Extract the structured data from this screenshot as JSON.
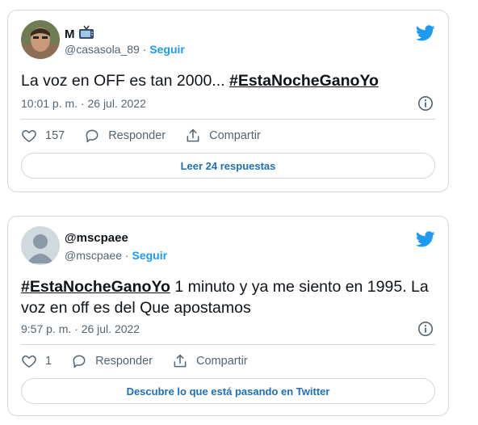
{
  "tweets": [
    {
      "name": "M",
      "name_emoji": "📺",
      "handle": "@casasola_89",
      "separator": "·",
      "follow_label": "Seguir",
      "text_before": "La voz en OFF es tan 2000... ",
      "hashtag": "#EstaNocheGanoYo",
      "text_after": "",
      "timestamp": "10:01 p. m. · 26 jul. 2022",
      "likes": "157",
      "reply_label": "Responder",
      "share_label": "Compartir",
      "footer_button": "Leer 24 respuestas"
    },
    {
      "name": "@mscpaee",
      "handle": "@mscpaee",
      "separator": "·",
      "follow_label": "Seguir",
      "hashtag": "#EstaNocheGanoYo",
      "text_after": " 1 minuto y ya me siento en 1995. La voz en off es del Que apostamos",
      "timestamp": "9:57 p. m. · 26 jul. 2022",
      "likes": "1",
      "reply_label": "Responder",
      "share_label": "Compartir",
      "footer_button": "Descubre lo que está pasando en Twitter"
    }
  ],
  "colors": {
    "brand": "#1d9bf0",
    "link": "#1d6fb8",
    "muted": "#536471",
    "border": "#cfd9de"
  },
  "icons": [
    "twitter-bird-icon",
    "info-icon",
    "heart-icon",
    "reply-bubble-icon",
    "share-icon"
  ]
}
